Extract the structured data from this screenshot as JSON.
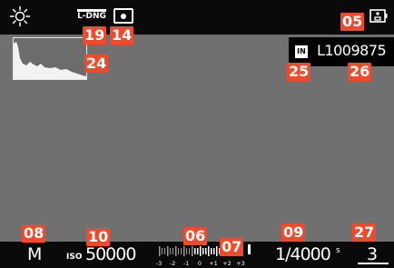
{
  "top_bar": {
    "white_balance_icon": "sun-icon",
    "file_format": "L-DNG",
    "metering_icon": "spot-metering-icon",
    "battery_icon": "battery-icon"
  },
  "overlay": {
    "histogram_icon": "histogram",
    "storage": "IN",
    "image_number": "L1009875"
  },
  "bottom_bar": {
    "mode": "M",
    "iso_label": "ISO",
    "iso_value": "50000",
    "exposure_scale_labels": [
      "-3",
      "-2",
      "-1",
      "0",
      "+1",
      "+2",
      "+3"
    ],
    "shutter_speed": "1/4000",
    "shutter_unit": "s",
    "shots_remaining": "3"
  },
  "callouts": {
    "c05": "05",
    "c06": "06",
    "c07": "07",
    "c08": "08",
    "c09": "09",
    "c10": "10",
    "c14": "14",
    "c19": "19",
    "c24": "24",
    "c25": "25",
    "c26": "26",
    "c27": "27"
  },
  "colors": {
    "background": "#707070",
    "bar": "#0a0a0a",
    "callout": "#f04a2a",
    "text": "#ffffff"
  }
}
